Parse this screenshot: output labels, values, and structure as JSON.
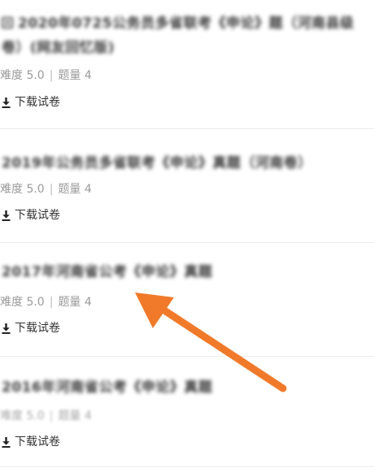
{
  "papers": [
    {
      "title": "2020年0725公务员多省联考《申论》题（河南县级卷）(网友回忆版)",
      "difficulty": "难度 5.0",
      "separator": "|",
      "count": "题量 4",
      "download_label": "下载试卷",
      "badge_icon": "paper-badge-icon"
    },
    {
      "title": "2019年公务员多省联考《申论》真题（河南卷）",
      "difficulty": "难度 5.0",
      "separator": "|",
      "count": "题量 4",
      "download_label": "下载试卷"
    },
    {
      "title": "2017年河南省公考《申论》真题",
      "difficulty": "难度 5.0",
      "separator": "|",
      "count": "题量 4",
      "download_label": "下载试卷"
    },
    {
      "title": "2016年河南省公考《申论》真题",
      "difficulty": "难度 5.0",
      "separator": "|",
      "count": "题量 4",
      "download_label": "下载试卷"
    }
  ],
  "icons": {
    "download": "download-icon",
    "annotation": "orange-arrow-annotation"
  },
  "colors": {
    "annotation_arrow": "#f07a2a",
    "meta_text": "#9a9a9a",
    "divider": "#ececec"
  }
}
